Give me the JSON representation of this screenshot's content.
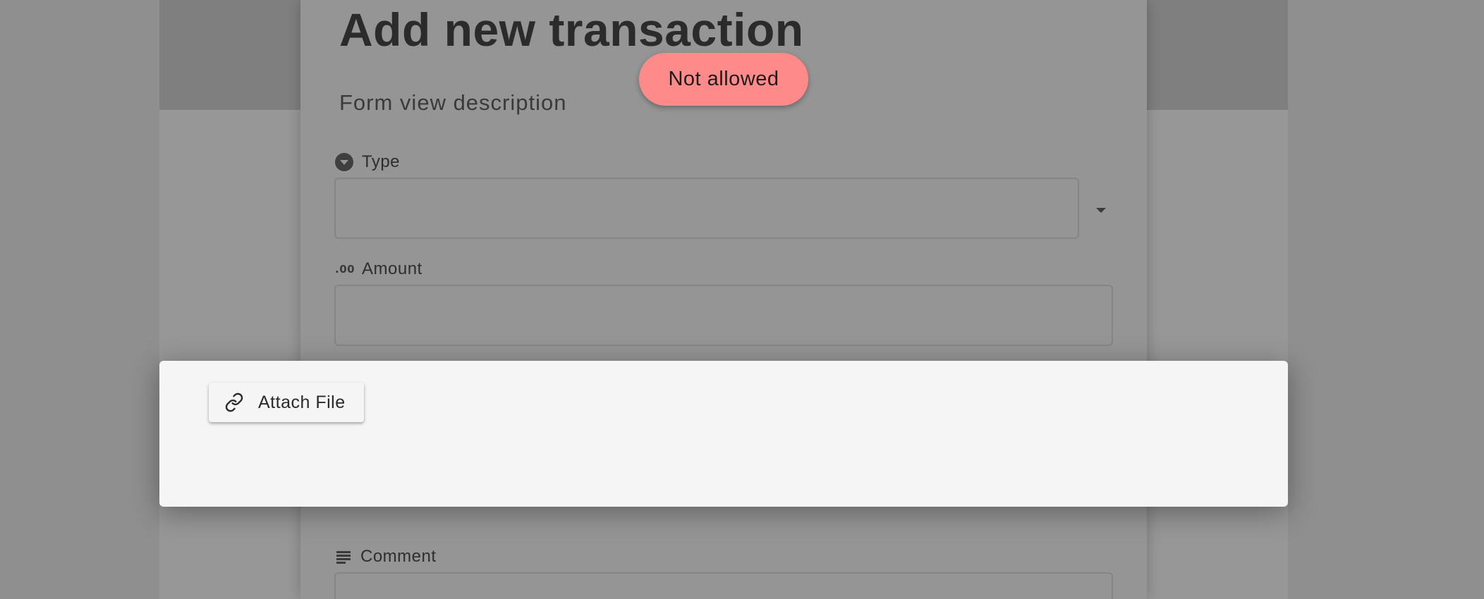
{
  "form": {
    "title": "Add new transaction",
    "description": "Form view description",
    "fields": {
      "type": {
        "label": "Type",
        "icon": "dropdown-circle-icon",
        "value": ""
      },
      "amount": {
        "label": "Amount",
        "icon": "decimal-icon",
        "icon_text": ".00",
        "value": ""
      },
      "comment": {
        "label": "Comment",
        "icon": "notes-lines-icon",
        "value": ""
      }
    }
  },
  "toast": {
    "message": "Not allowed",
    "color": "#ff8a8a"
  },
  "attach": {
    "button_label": "Attach File",
    "icon": "link-icon"
  }
}
